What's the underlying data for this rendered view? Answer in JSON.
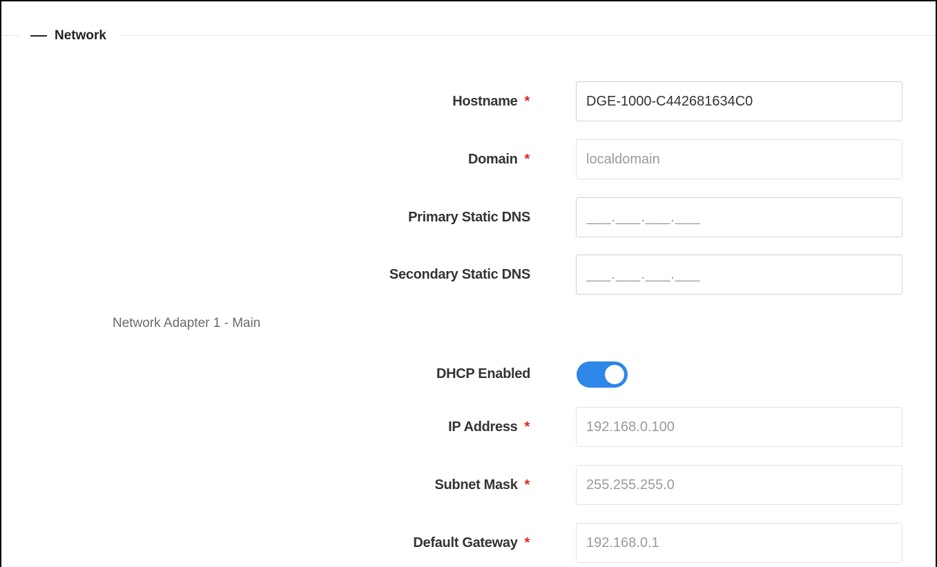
{
  "section": {
    "title": "Network",
    "collapse_icon": "minus-icon"
  },
  "fields": {
    "hostname": {
      "label": "Hostname",
      "required": "*",
      "value": "DGE-1000-C442681634C0"
    },
    "domain": {
      "label": "Domain",
      "required": "*",
      "value": "localdomain"
    },
    "primary_dns": {
      "label": "Primary Static DNS",
      "mask": "___.___.___.___"
    },
    "secondary_dns": {
      "label": "Secondary Static DNS",
      "mask": "___.___.___.___"
    }
  },
  "adapter": {
    "title": "Network Adapter 1 - Main",
    "dhcp": {
      "label": "DHCP Enabled",
      "enabled": true
    },
    "ip_address": {
      "label": "IP Address",
      "required": "*",
      "value": "192.168.0.100"
    },
    "subnet_mask": {
      "label": "Subnet Mask",
      "required": "*",
      "value": "255.255.255.0"
    },
    "default_gateway": {
      "label": "Default Gateway",
      "required": "*",
      "value": "192.168.0.1"
    }
  },
  "colors": {
    "required": "#e0241b",
    "toggle_on": "#2e86e8"
  }
}
